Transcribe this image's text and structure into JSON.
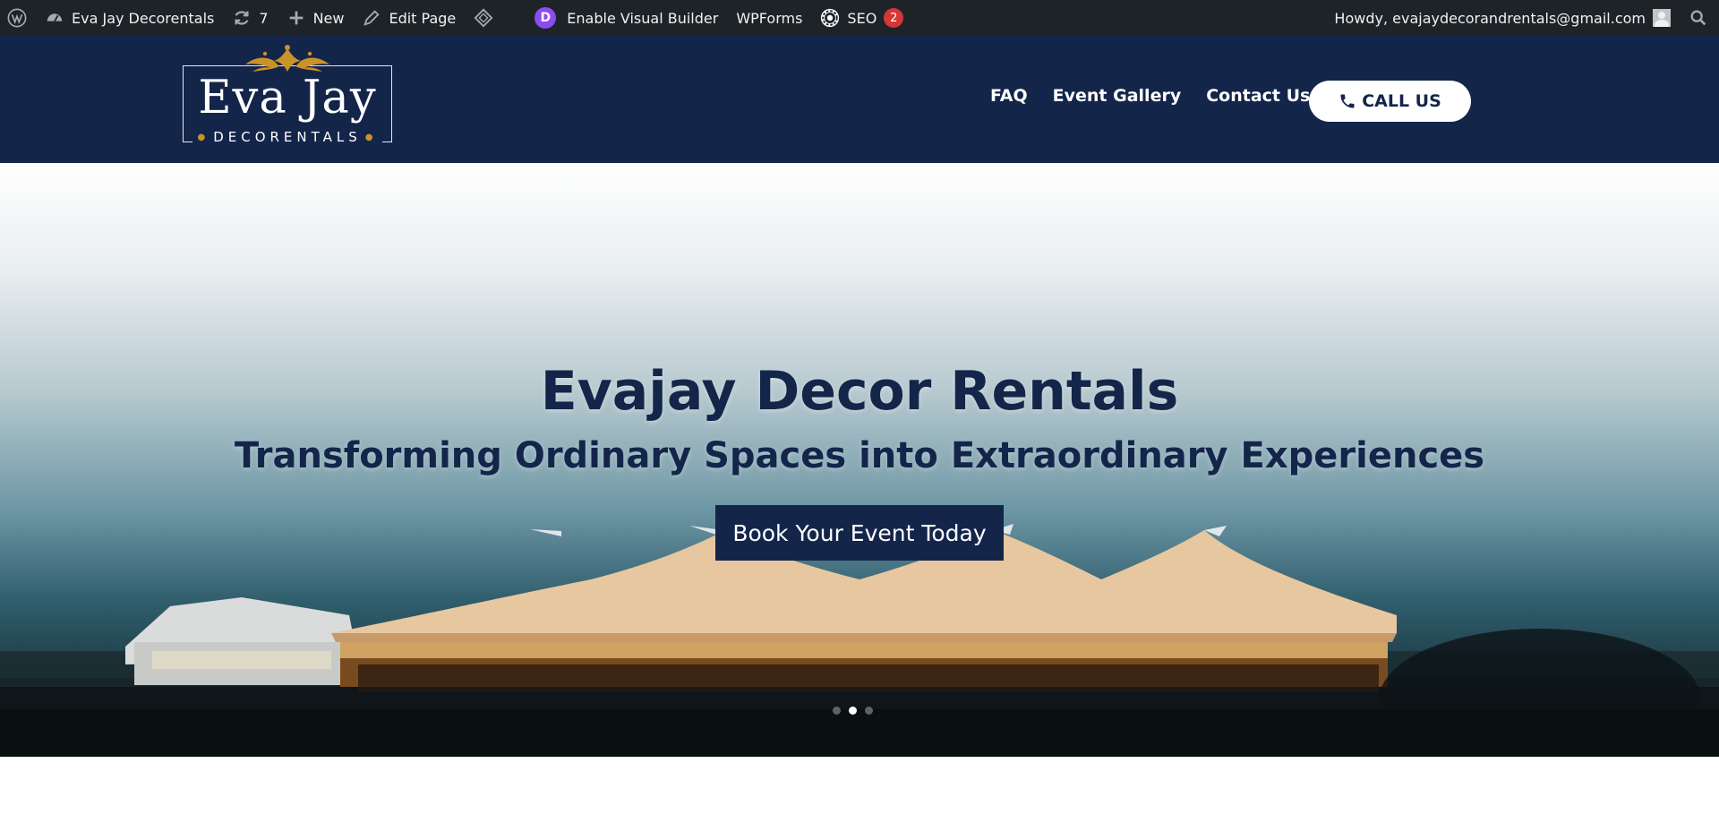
{
  "admin_bar": {
    "site_name": "Eva Jay Decorentals",
    "updates_count": "7",
    "new_label": "New",
    "edit_page_label": "Edit Page",
    "divi_badge": "D",
    "visual_builder_label": "Enable Visual Builder",
    "wpforms_label": "WPForms",
    "seo_label": "SEO",
    "seo_count": "2",
    "howdy_text": "Howdy, evajaydecorandrentals@gmail.com"
  },
  "header": {
    "logo_name": "Eva Jay",
    "logo_sub": "DECORENTALS",
    "nav": [
      "FAQ",
      "Event Gallery",
      "Contact Us"
    ],
    "call_button_label": "CALL US"
  },
  "hero": {
    "title": "Evajay Decor Rentals",
    "subtitle": "Transforming Ordinary Spaces into Extraordinary Experiences",
    "cta_label": "Book Your Event Today",
    "slides_total": 3,
    "active_slide": 2
  },
  "colors": {
    "admin_bar_bg": "#1d2327",
    "header_bg": "#14254a",
    "accent_gold": "#c9932a",
    "seo_badge": "#d63638",
    "divi_purple": "#8c4bf0"
  },
  "icons": {
    "wp_logo": "wordpress-icon",
    "dashboard": "dashboard-icon",
    "updates": "updates-icon",
    "new": "plus-icon",
    "edit": "pencil-icon",
    "diamond": "divi-diamond-icon",
    "seo": "seo-gear-icon",
    "search": "search-icon",
    "phone": "phone-icon"
  }
}
